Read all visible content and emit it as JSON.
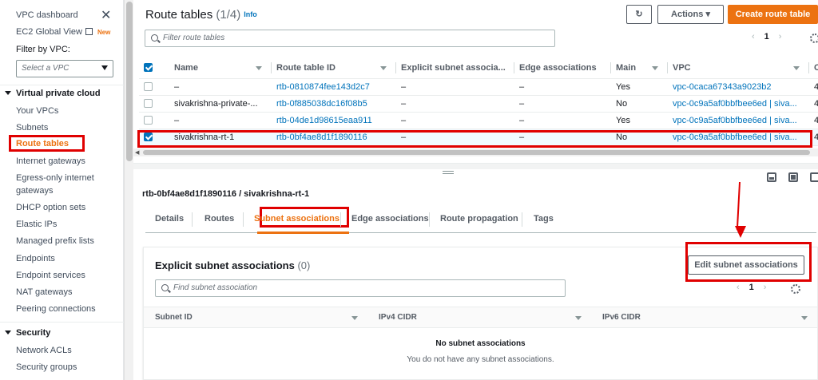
{
  "sidebar": {
    "vpc_dashboard": "VPC dashboard",
    "ec2_global_view": "EC2 Global View",
    "new_badge": "New",
    "filter_label": "Filter by VPC:",
    "filter_placeholder": "Select a VPC",
    "section_vpc": "Virtual private cloud",
    "items": [
      "Your VPCs",
      "Subnets",
      "Route tables",
      "Internet gateways",
      "Egress-only internet",
      "gateways",
      "DHCP option sets",
      "Elastic IPs",
      "Managed prefix lists",
      "Endpoints",
      "Endpoint services",
      "NAT gateways",
      "Peering connections"
    ],
    "section_security": "Security",
    "security_items": [
      "Network ACLs",
      "Security groups"
    ]
  },
  "header": {
    "title": "Route tables",
    "count": "(1/4)",
    "info": "Info",
    "actions": "Actions",
    "create": "Create route table",
    "search_placeholder": "Filter route tables",
    "page": "1"
  },
  "table": {
    "columns": [
      "Name",
      "Route table ID",
      "Explicit subnet associa...",
      "Edge associations",
      "Main",
      "VPC",
      "C"
    ],
    "rows": [
      {
        "name": "–",
        "id": "rtb-0810874fee143d2c7",
        "explicit": "–",
        "edge": "–",
        "main": "Yes",
        "vpc": "vpc-0caca67343a9023b2",
        "extra": "4"
      },
      {
        "name": "sivakrishna-private-...",
        "id": "rtb-0f885038dc16f08b5",
        "explicit": "–",
        "edge": "–",
        "main": "No",
        "vpc": "vpc-0c9a5af0bbfbee6ed | siva...",
        "extra": "4"
      },
      {
        "name": "–",
        "id": "rtb-04de1d98615eaa911",
        "explicit": "–",
        "edge": "–",
        "main": "Yes",
        "vpc": "vpc-0c9a5af0bbfbee6ed | siva...",
        "extra": "4"
      },
      {
        "name": "sivakrishna-rt-1",
        "id": "rtb-0bf4ae8d1f1890116",
        "explicit": "–",
        "edge": "–",
        "main": "No",
        "vpc": "vpc-0c9a5af0bbfbee6ed | siva...",
        "extra": "4"
      }
    ]
  },
  "detail": {
    "title": "rtb-0bf4ae8d1f1890116 / sivakrishna-rt-1",
    "tabs": [
      "Details",
      "Routes",
      "Subnet associations",
      "Edge associations",
      "Route propagation",
      "Tags"
    ]
  },
  "panel": {
    "title": "Explicit subnet associations",
    "count": "(0)",
    "edit_button": "Edit subnet associations",
    "search_placeholder": "Find subnet association",
    "page": "1",
    "columns": [
      "Subnet ID",
      "IPv4 CIDR",
      "IPv6 CIDR"
    ],
    "empty_title": "No subnet associations",
    "empty_desc": "You do not have any subnet associations."
  }
}
